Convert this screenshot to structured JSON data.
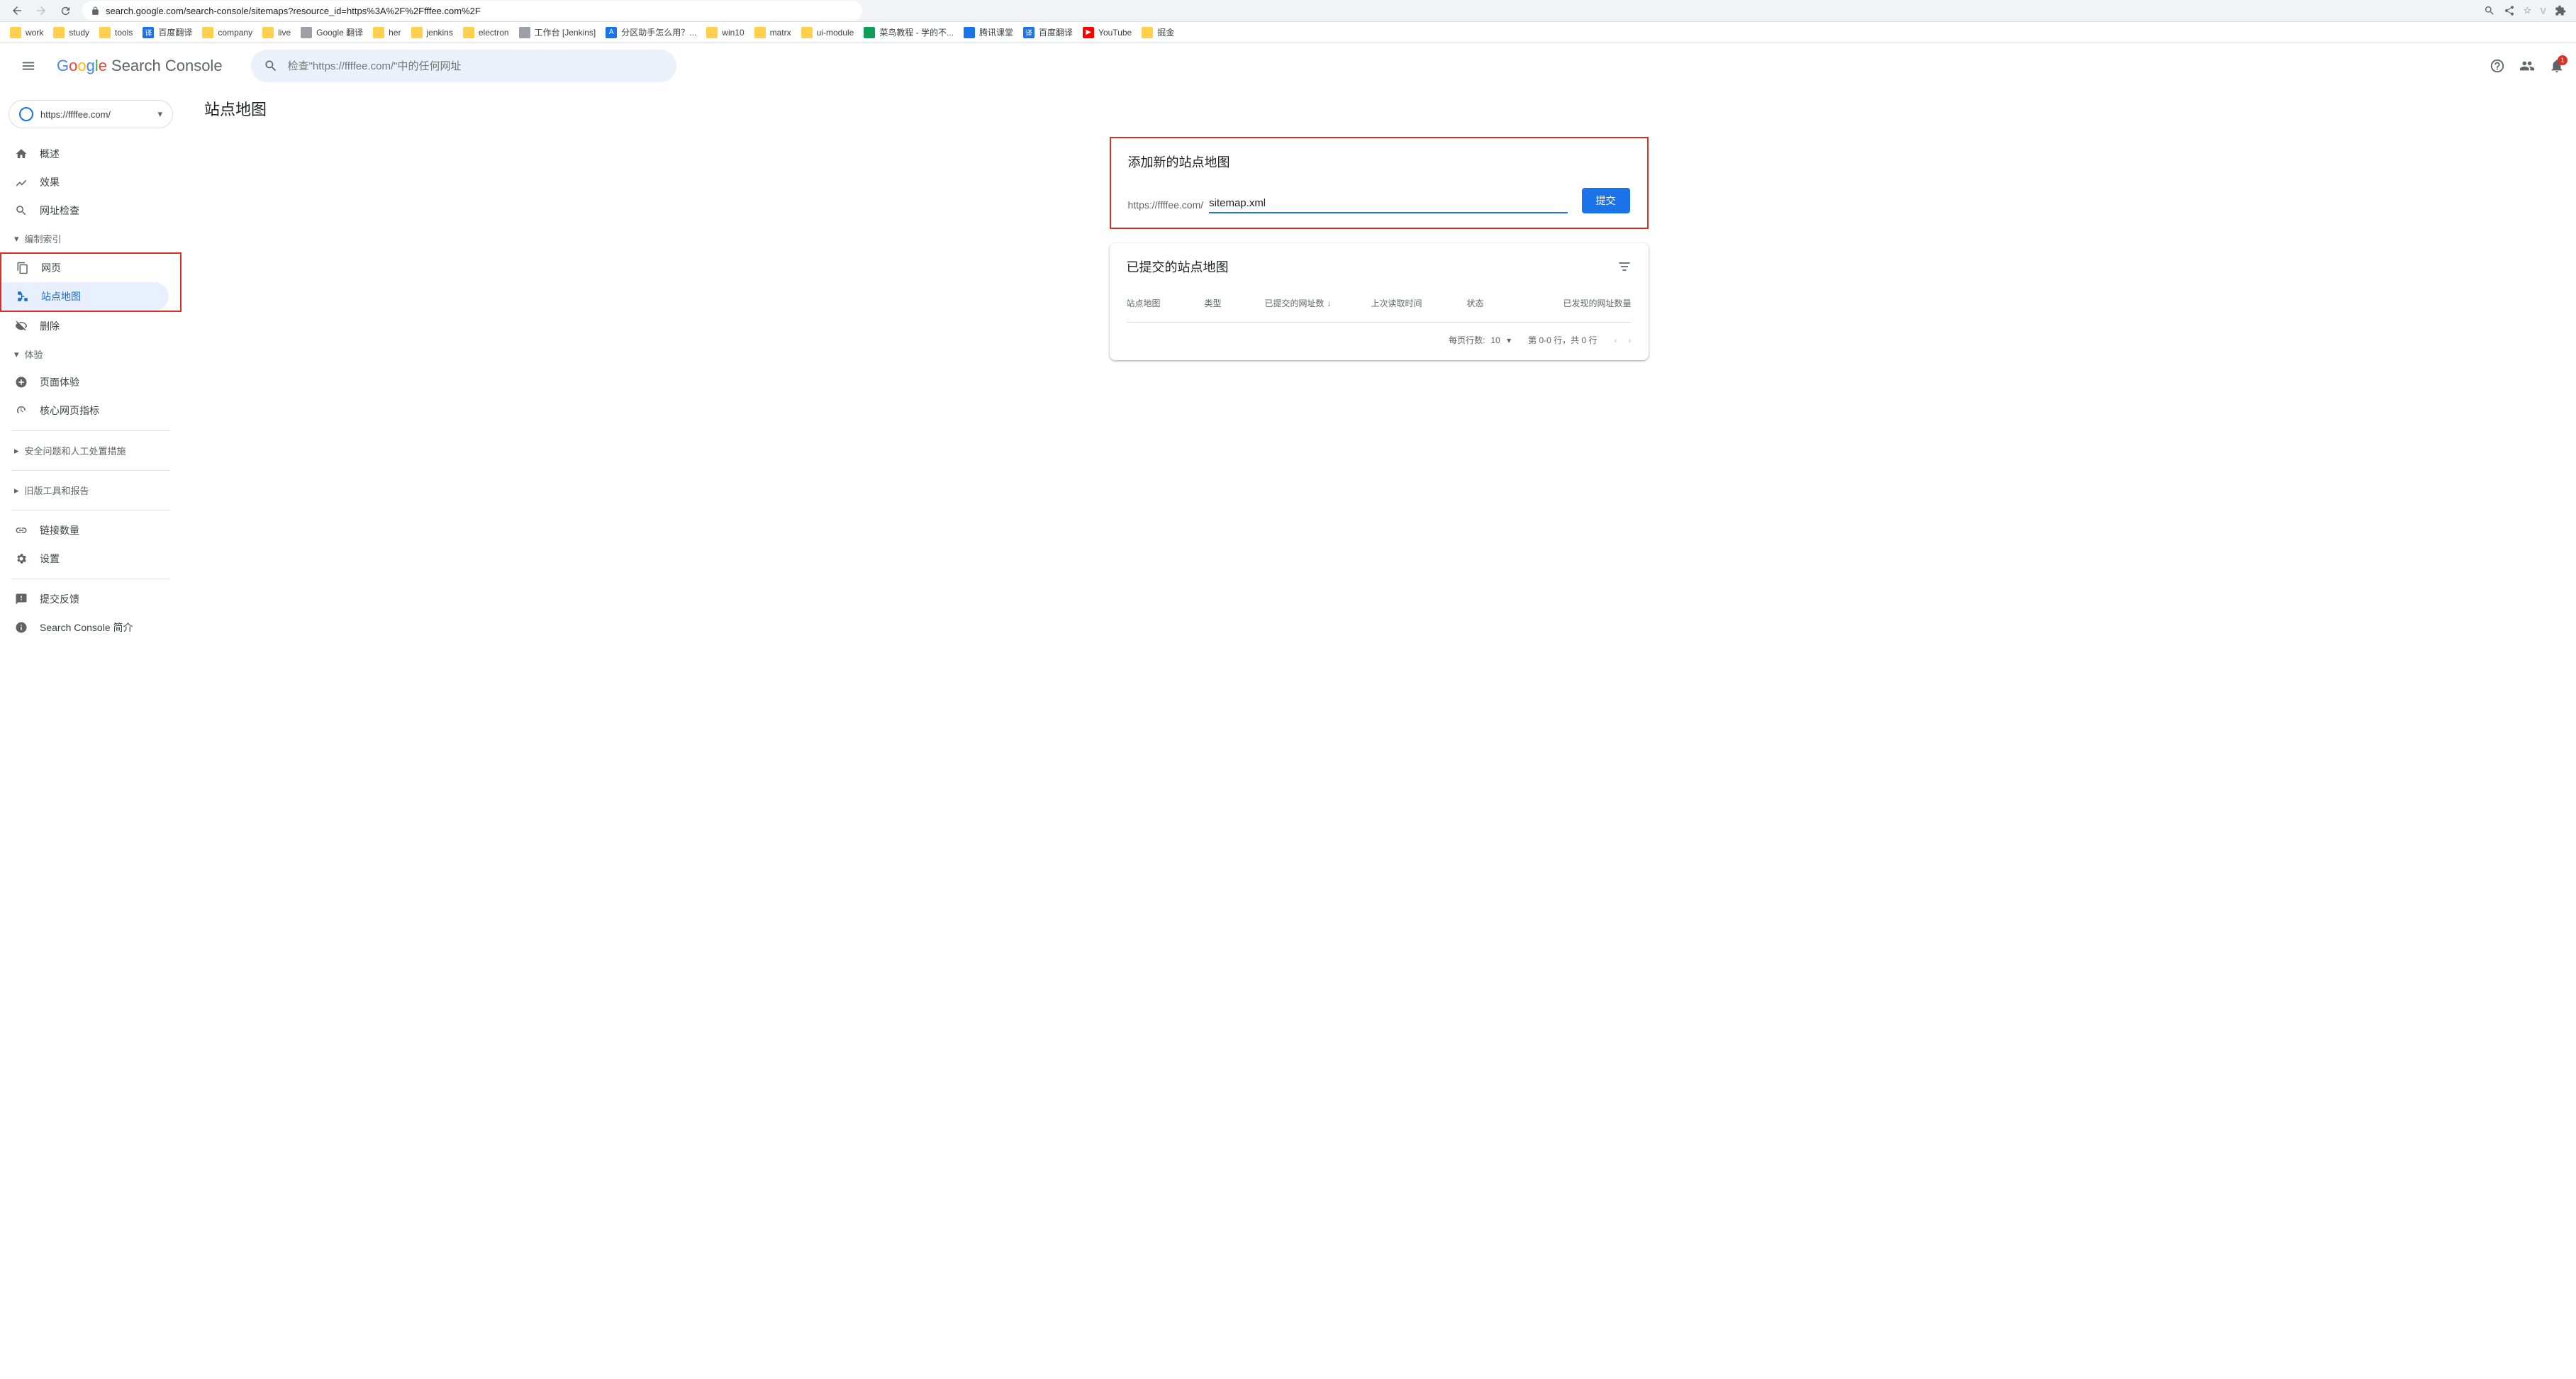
{
  "browser": {
    "url": "search.google.com/search-console/sitemaps?resource_id=https%3A%2F%2Ffffee.com%2F"
  },
  "bookmarks": [
    {
      "label": "work",
      "type": "folder"
    },
    {
      "label": "study",
      "type": "folder"
    },
    {
      "label": "tools",
      "type": "folder"
    },
    {
      "label": "百度翻译",
      "type": "blue"
    },
    {
      "label": "company",
      "type": "folder"
    },
    {
      "label": "live",
      "type": "folder"
    },
    {
      "label": "Google 翻译",
      "type": "gray"
    },
    {
      "label": "her",
      "type": "folder"
    },
    {
      "label": "jenkins",
      "type": "folder"
    },
    {
      "label": "electron",
      "type": "folder"
    },
    {
      "label": "工作台 [Jenkins]",
      "type": "gray"
    },
    {
      "label": "分区助手怎么用？...",
      "type": "blue"
    },
    {
      "label": "win10",
      "type": "folder"
    },
    {
      "label": "matrx",
      "type": "folder"
    },
    {
      "label": "ui-module",
      "type": "folder"
    },
    {
      "label": "菜鸟教程 - 学的不...",
      "type": "green"
    },
    {
      "label": "腾讯课堂",
      "type": "blue"
    },
    {
      "label": "百度翻译",
      "type": "blue"
    },
    {
      "label": "YouTube",
      "type": "red"
    },
    {
      "label": "掘金",
      "type": "folder"
    }
  ],
  "header": {
    "product": "Search Console",
    "search_placeholder": "检查\"https://ffffee.com/\"中的任何网址",
    "notif_count": "1"
  },
  "sidebar": {
    "property": "https://ffffee.com/",
    "items": {
      "overview": "概述",
      "performance": "效果",
      "url_inspect": "网址检查",
      "section_indexing": "编制索引",
      "pages": "网页",
      "sitemaps": "站点地图",
      "removals": "删除",
      "section_experience": "体验",
      "page_exp": "页面体验",
      "cwv": "核心网页指标",
      "security": "安全问题和人工处置措施",
      "legacy": "旧版工具和报告",
      "links": "链接数量",
      "settings": "设置",
      "feedback": "提交反馈",
      "about": "Search Console 简介"
    }
  },
  "main": {
    "page_title": "站点地图",
    "add_card": {
      "title": "添加新的站点地图",
      "url_prefix": "https://ffffee.com/",
      "input_value": "sitemap.xml",
      "submit": "提交"
    },
    "submitted_card": {
      "title": "已提交的站点地图",
      "columns": {
        "c1": "站点地图",
        "c2": "类型",
        "c3": "已提交的网址数",
        "c4": "上次读取时间",
        "c5": "状态",
        "c6": "已发现的网址数量"
      },
      "rows_per_page_label": "每页行数:",
      "rows_per_page": "10",
      "range": "第 0-0 行，共 0 行"
    }
  }
}
